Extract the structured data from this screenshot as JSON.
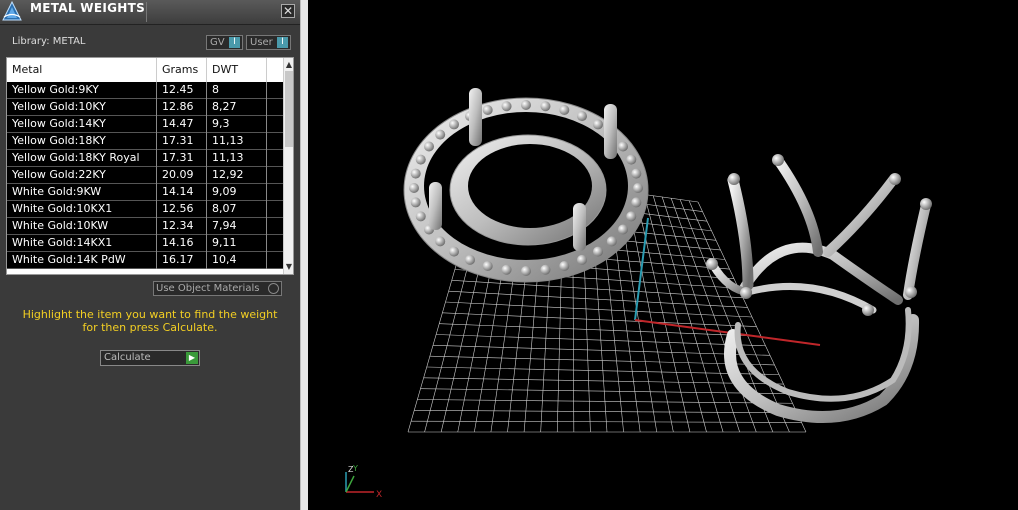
{
  "window": {
    "title": "METAL WEIGHTS",
    "close_glyph": "✕"
  },
  "library": {
    "label": "Library: METAL",
    "toggles": [
      {
        "label": "GV",
        "knob": "I"
      },
      {
        "label": "User",
        "knob": "I"
      }
    ]
  },
  "table": {
    "columns": [
      "Metal",
      "Grams",
      "DWT"
    ],
    "rows": [
      {
        "metal": "Yellow Gold:9KY",
        "grams": "12.45",
        "dwt": "8"
      },
      {
        "metal": "Yellow Gold:10KY",
        "grams": "12.86",
        "dwt": "8,27"
      },
      {
        "metal": "Yellow Gold:14KY",
        "grams": "14.47",
        "dwt": "9,3"
      },
      {
        "metal": "Yellow Gold:18KY",
        "grams": "17.31",
        "dwt": "11,13"
      },
      {
        "metal": "Yellow Gold:18KY Royal",
        "grams": "17.31",
        "dwt": "11,13"
      },
      {
        "metal": "Yellow Gold:22KY",
        "grams": "20.09",
        "dwt": "12,92"
      },
      {
        "metal": "White Gold:9KW",
        "grams": "14.14",
        "dwt": "9,09"
      },
      {
        "metal": "White Gold:10KX1",
        "grams": "12.56",
        "dwt": "8,07"
      },
      {
        "metal": "White Gold:10KW",
        "grams": "12.34",
        "dwt": "7,94"
      },
      {
        "metal": "White Gold:14KX1",
        "grams": "14.16",
        "dwt": "9,11"
      },
      {
        "metal": "White Gold:14K PdW",
        "grams": "16.17",
        "dwt": "10,4"
      }
    ],
    "scroll_up": "▲",
    "scroll_down": "▼"
  },
  "use_object_materials": {
    "label": "Use Object Materials"
  },
  "hint": {
    "line1": "Highlight the item you want to find the weight",
    "line2": "for then press Calculate."
  },
  "calculate": {
    "label": "Calculate",
    "go": "▶"
  },
  "viewport": {
    "axis_labels": {
      "x": "X",
      "y": "Y",
      "z": "Z"
    },
    "colors": {
      "background": "#000000",
      "grid": "#cfcfcf",
      "axis_x": "#c0262a",
      "axis_y": "#2b9db3",
      "model": "#d9d9d9"
    },
    "icons": [
      "3d-app-icon",
      "axis-gizmo-icon"
    ]
  }
}
